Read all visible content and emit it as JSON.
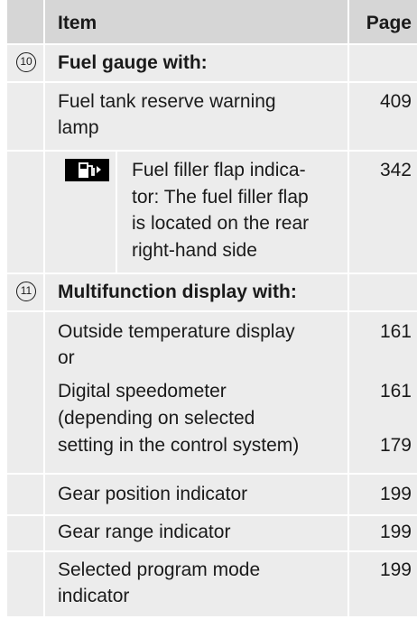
{
  "header": {
    "item": "Item",
    "page": "Page"
  },
  "sections": [
    {
      "number": "10",
      "title": "Fuel gauge with:",
      "entries": [
        {
          "text_lines": [
            "Fuel tank reserve warning",
            "lamp"
          ],
          "page": "409"
        },
        {
          "icon": "fuel-pump-icon",
          "text_lines": [
            "Fuel filler flap indica-",
            "tor: The fuel filler flap",
            "is located on the rear",
            "right-hand side"
          ],
          "page": "342"
        }
      ]
    },
    {
      "number": "11",
      "title": "Multifunction display with:",
      "entries": [
        {
          "text_lines": [
            "Outside temperature display",
            "or"
          ],
          "page": "161"
        },
        {
          "text_lines": [
            "Digital speedometer",
            "(depending on selected",
            "setting in the control system)"
          ],
          "pages": [
            "161",
            "179"
          ]
        },
        {
          "text_lines": [
            "Gear position indicator"
          ],
          "page": "199"
        },
        {
          "text_lines": [
            "Gear range indicator"
          ],
          "page": "199"
        },
        {
          "text_lines": [
            "Selected program mode",
            "indicator"
          ],
          "page": "199"
        }
      ]
    }
  ]
}
